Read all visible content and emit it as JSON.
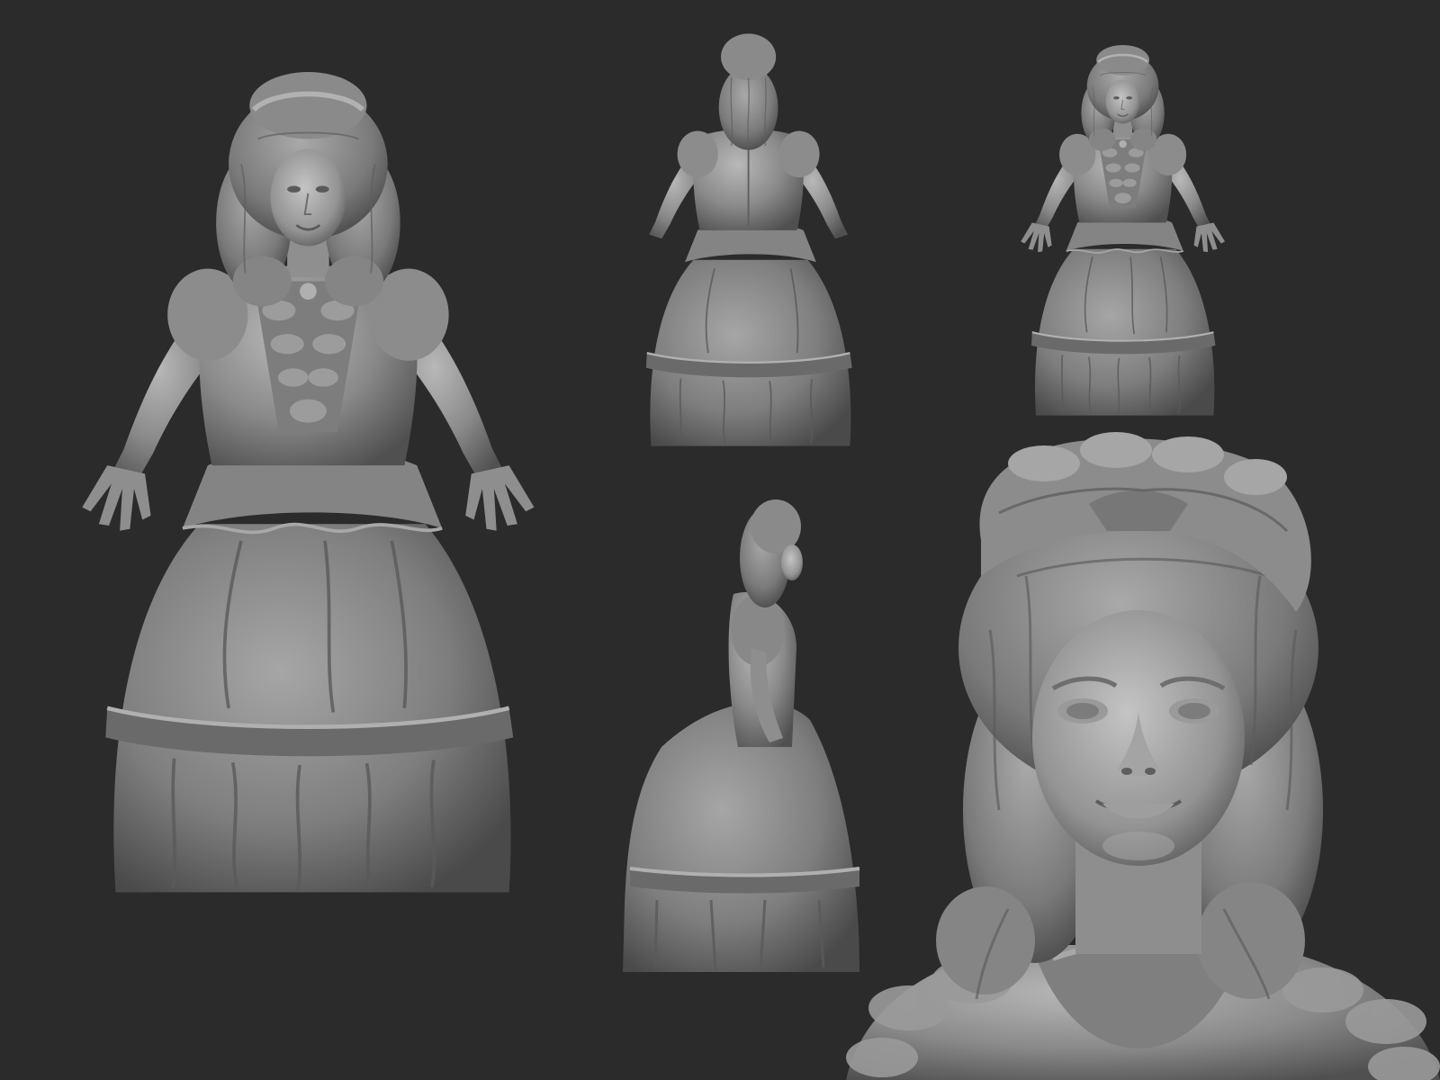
{
  "canvas": {
    "background": "#2b2b2b",
    "clay": "#8a8a8a",
    "clay_light": "#b4b4b4",
    "clay_dark": "#4e4e4e"
  },
  "views": [
    {
      "id": "front-full",
      "label": ""
    },
    {
      "id": "back",
      "label": ""
    },
    {
      "id": "front-small",
      "label": ""
    },
    {
      "id": "side",
      "label": ""
    },
    {
      "id": "bust-closeup",
      "label": ""
    }
  ]
}
